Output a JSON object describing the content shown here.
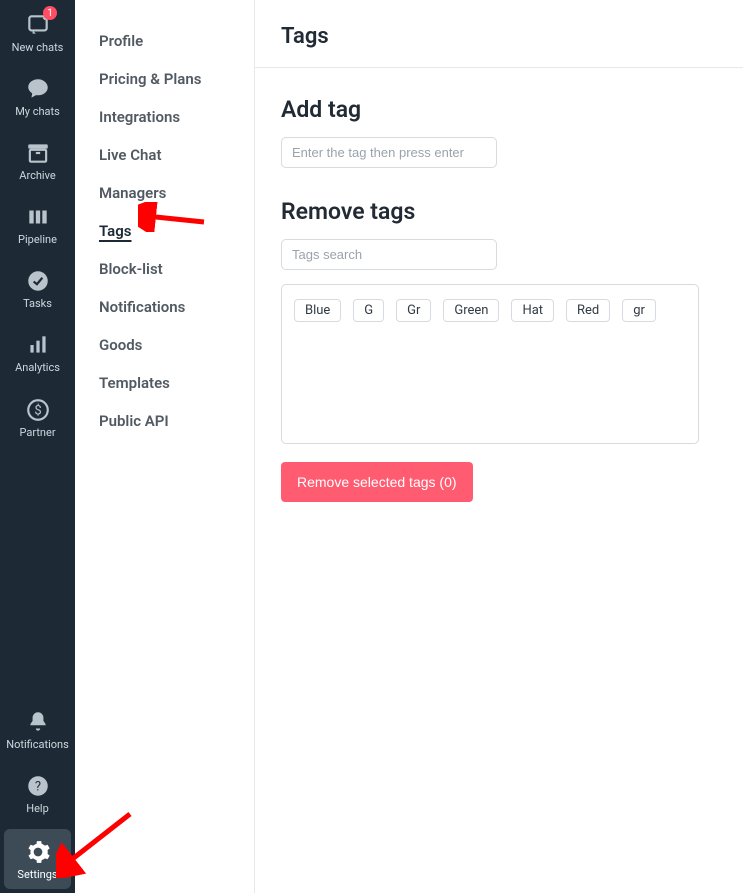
{
  "rail": {
    "top_items": [
      {
        "key": "new-chats",
        "label": "New chats",
        "badge": "1",
        "icon": "chat-plus-icon"
      },
      {
        "key": "my-chats",
        "label": "My chats",
        "icon": "speech-bubble-icon"
      },
      {
        "key": "archive",
        "label": "Archive",
        "icon": "archive-box-icon"
      },
      {
        "key": "pipeline",
        "label": "Pipeline",
        "icon": "columns-icon"
      },
      {
        "key": "tasks",
        "label": "Tasks",
        "icon": "check-circle-icon"
      },
      {
        "key": "analytics",
        "label": "Analytics",
        "icon": "bar-chart-icon"
      },
      {
        "key": "partner",
        "label": "Partner",
        "icon": "dollar-circle-icon"
      }
    ],
    "bottom_items": [
      {
        "key": "notifications",
        "label": "Notifications",
        "icon": "bell-icon"
      },
      {
        "key": "help",
        "label": "Help",
        "icon": "question-circle-icon"
      },
      {
        "key": "settings",
        "label": "Settings",
        "icon": "gear-icon",
        "active": true
      }
    ]
  },
  "submenu": {
    "items": [
      {
        "label": "Profile"
      },
      {
        "label": "Pricing & Plans"
      },
      {
        "label": "Integrations"
      },
      {
        "label": "Live Chat"
      },
      {
        "label": "Managers"
      },
      {
        "label": "Tags",
        "active": true
      },
      {
        "label": "Block-list"
      },
      {
        "label": "Notifications"
      },
      {
        "label": "Goods"
      },
      {
        "label": "Templates"
      },
      {
        "label": "Public API"
      }
    ]
  },
  "page": {
    "title": "Tags",
    "add_section_title": "Add tag",
    "add_placeholder": "Enter the tag then press enter",
    "remove_section_title": "Remove tags",
    "search_placeholder": "Tags search",
    "tags": [
      "Blue",
      "G",
      "Gr",
      "Green",
      "Hat",
      "Red",
      "gr"
    ],
    "remove_button_label": "Remove selected tags (0)"
  },
  "colors": {
    "rail_bg": "#1d2a36",
    "accent_red": "#ff5c72",
    "badge_red": "#ff4d63"
  }
}
